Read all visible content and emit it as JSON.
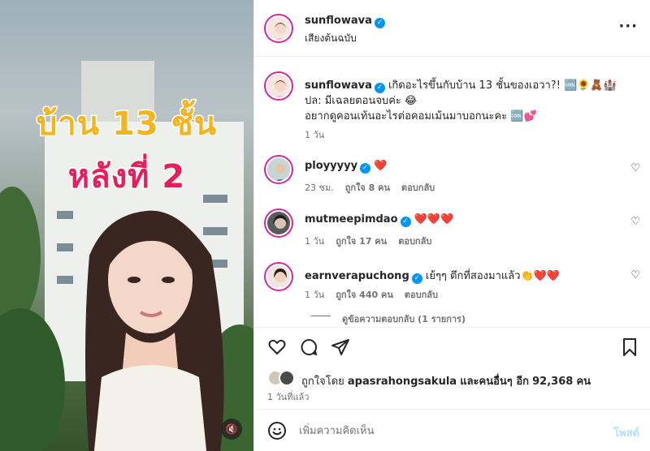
{
  "post": {
    "author": "sunflowava",
    "audio_label": "เสียงต้นฉบับ",
    "video_title_line1": "บ้าน 13 ชั้น",
    "video_title_line2": "หลังที่ 2",
    "caption_line1": "เกิดอะไรขึ้นกับบ้าน 13 ชั้นของเอวา?! 🆒🌻🧸🏰",
    "caption_line2": "ปล: มีเฉลยตอนจบค่ะ 😂",
    "caption_line3": "อยากดูคอนเท้นอะไรต่อคอมเม้นมาบอกนะคะ 🆒💕",
    "caption_time": "1 วัน"
  },
  "comments": [
    {
      "user": "ployyyyy",
      "text": "❤️",
      "time": "23 ชม.",
      "likes": "ถูกใจ 8 คน",
      "reply": "ตอบกลับ"
    },
    {
      "user": "mutmeepimdao",
      "text": "❤️❤️❤️",
      "time": "1 วัน",
      "likes": "ถูกใจ 17 คน",
      "reply": "ตอบกลับ"
    },
    {
      "user": "earnverapuchong",
      "text": "เย้ๆๆ ตึกที่สองมาแล้ว👏❤️❤️",
      "time": "1 วัน",
      "likes": "ถูกใจ 440 คน",
      "reply": "ตอบกลับ"
    }
  ],
  "view_replies": "ดูข้อความตอบกลับ (1 รายการ)",
  "likes_summary": {
    "prefix": "ถูกใจโดย",
    "user": "apasrahongsakula",
    "middle": "และคนอื่นๆ อีก",
    "count": "92,368",
    "suffix": "คน"
  },
  "post_time": "1 วันที่แล้ว",
  "comment_input": {
    "placeholder": "เพิ่มความคิดเห็น",
    "post_button": "โพสต์"
  },
  "icons": [
    "more-icon",
    "heart-icon",
    "comment-icon",
    "share-icon",
    "bookmark-icon",
    "emoji-icon",
    "mute-icon",
    "verified-icon"
  ],
  "colors": {
    "verified": "#0095f6",
    "like_red": "#ed4956",
    "post_button": "#b2dffc",
    "title_yellow": "#f2b51e",
    "title_pink": "#e61f5b"
  }
}
